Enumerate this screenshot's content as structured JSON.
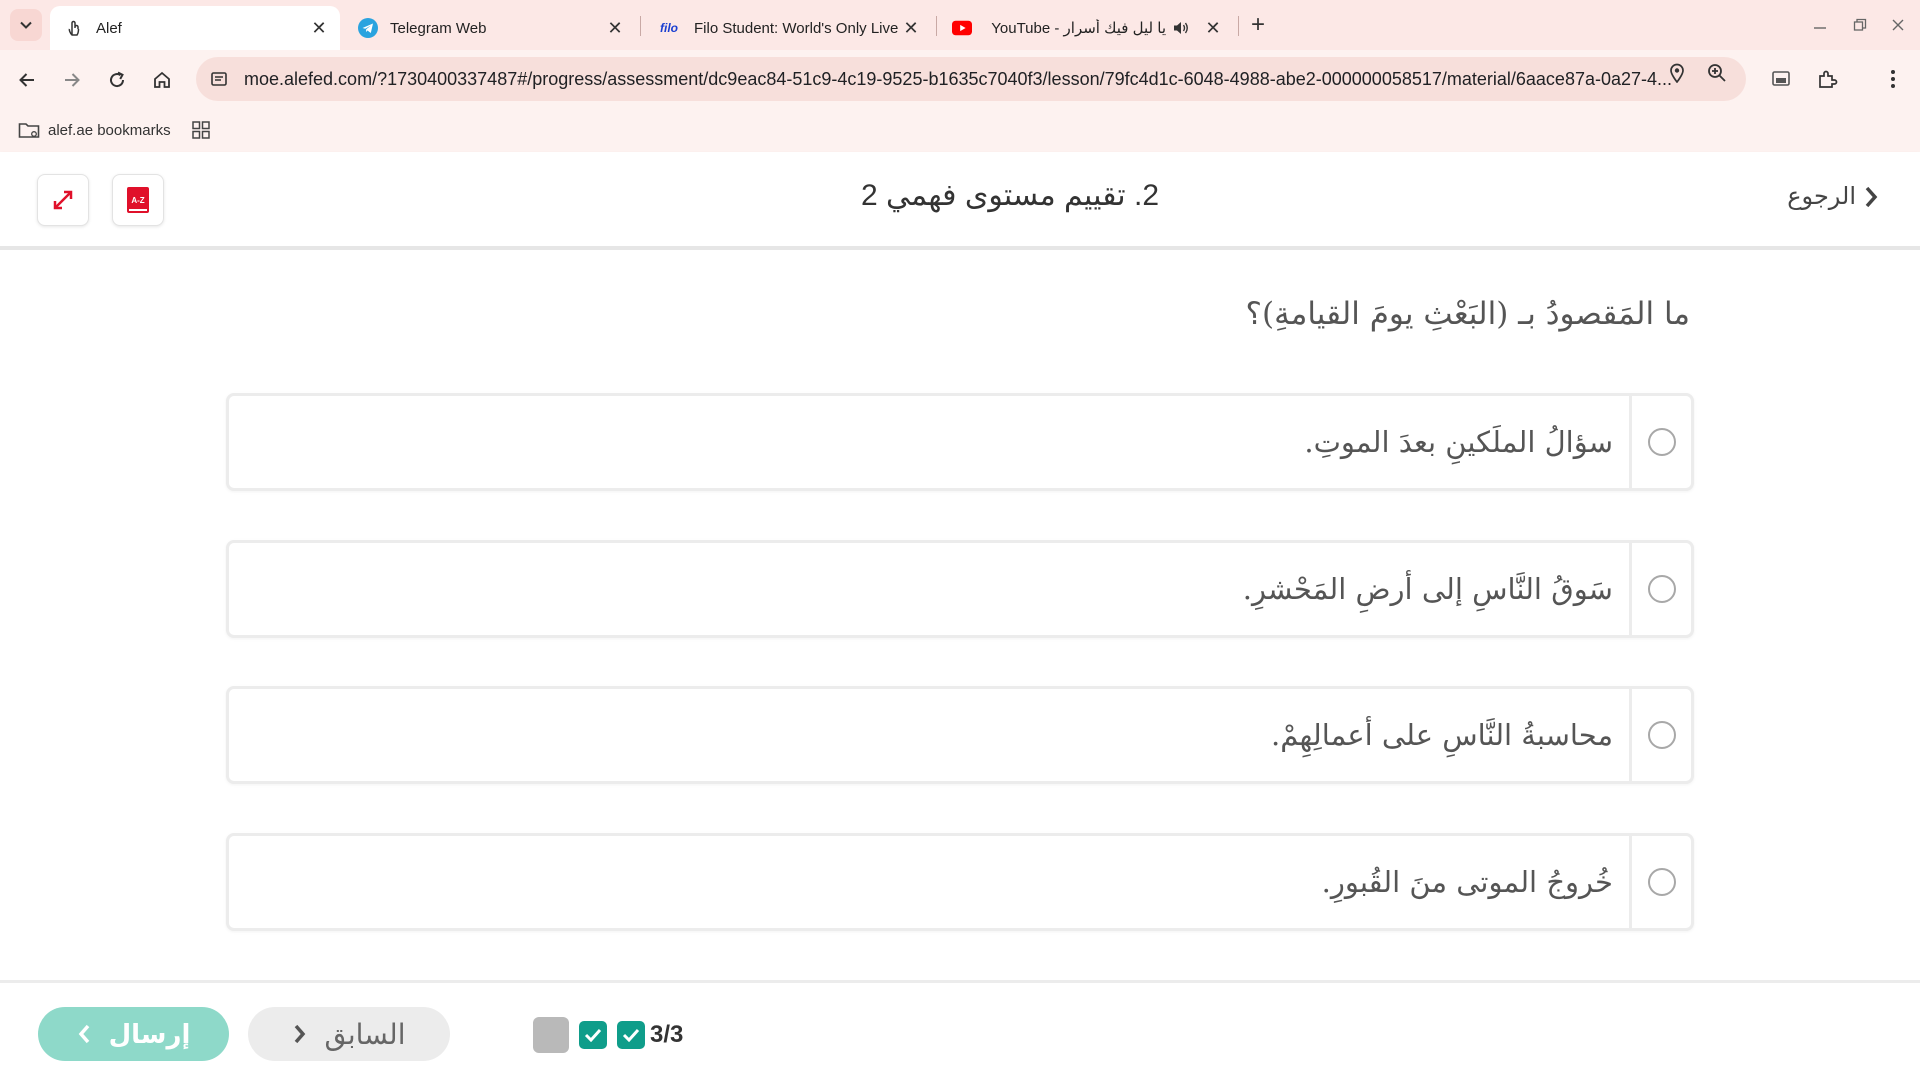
{
  "browser": {
    "tabs": [
      {
        "title": "Alef",
        "active": true,
        "favicon": "hand-pointer-icon"
      },
      {
        "title": "Telegram Web",
        "active": false,
        "favicon": "telegram-icon"
      },
      {
        "title": "Filo Student: World's Only Live I",
        "active": false,
        "favicon": "filo-icon",
        "favicon_text": "filo"
      },
      {
        "title": "YouTube - يا ليل فيك أسرار",
        "active": false,
        "favicon": "youtube-icon",
        "audio": true
      }
    ],
    "url": "moe.alefed.com/?1730400337487#/progress/assessment/dc9eac84-51c9-4c19-9525-b1635c7040f3/lesson/79fc4d1c-6048-4988-abe2-000000058517/material/6aace87a-0a27-4...",
    "bookmarks": [
      {
        "label": "alef.ae bookmarks"
      }
    ],
    "colors": {
      "tabbar": "#fce8e6",
      "toolbar": "#fdf2f0",
      "omnibox": "#f7dfdb"
    }
  },
  "header": {
    "title": "2. تقييم مستوى فهمي 2",
    "back_label": "الرجوع",
    "dictionary_label": "A-Z",
    "accent": "#e0102a"
  },
  "question": {
    "text": "ما المَقصودُ بـ (البَعْثِ يومَ القيامةِ)؟",
    "options": [
      {
        "text": "سؤالُ الملَكينِ بعدَ الموتِ.",
        "selected": false
      },
      {
        "text": "سَوقُ النَّاسِ إلى أرضِ المَحْشرِ.",
        "selected": false
      },
      {
        "text": "محاسبةُ النَّاسِ على أعمالِهِمْ.",
        "selected": false
      },
      {
        "text": "خُروجُ الموتى منَ القُبورِ.",
        "selected": false
      }
    ]
  },
  "footer": {
    "submit_label": "إرسال",
    "prev_label": "السابق",
    "progress": {
      "answered": 3,
      "total": 3,
      "label": "3/3"
    },
    "colors": {
      "submit": "#8ed9c9",
      "check": "#0f9d8a"
    }
  }
}
